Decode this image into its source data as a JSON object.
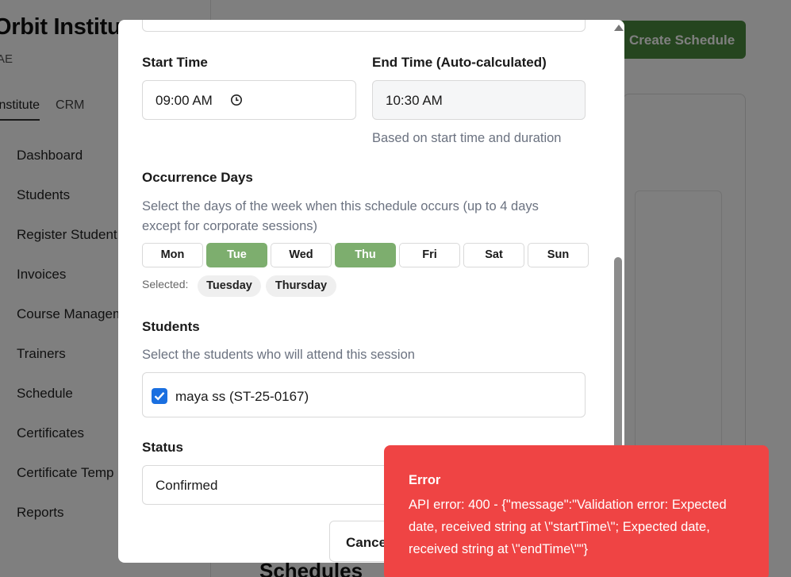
{
  "background": {
    "brand": "Orbit Institu",
    "brand_sub": "AE",
    "tabs": [
      "Institute",
      "CRM"
    ],
    "nav": [
      "Dashboard",
      "Students",
      "Register Student",
      "Invoices",
      "Course Managem",
      "Trainers",
      "Schedule",
      "Certificates",
      "Certificate Temp",
      "Reports"
    ],
    "create_button": "Create Schedule",
    "section_title": "Schedules"
  },
  "modal": {
    "start_time": {
      "label": "Start Time",
      "value": "09:00 AM"
    },
    "end_time": {
      "label": "End Time (Auto-calculated)",
      "value": "10:30 AM",
      "help": "Based on start time and duration"
    },
    "occurrence": {
      "label": "Occurrence Days",
      "help": "Select the days of the week when this schedule occurs (up to 4 days except for corporate sessions)",
      "days": [
        {
          "label": "Mon",
          "selected": false
        },
        {
          "label": "Tue",
          "selected": true
        },
        {
          "label": "Wed",
          "selected": false
        },
        {
          "label": "Thu",
          "selected": true
        },
        {
          "label": "Fri",
          "selected": false
        },
        {
          "label": "Sat",
          "selected": false
        },
        {
          "label": "Sun",
          "selected": false
        }
      ],
      "selected_label": "Selected:",
      "selected_chips": [
        "Tuesday",
        "Thursday"
      ]
    },
    "students": {
      "label": "Students",
      "help": "Select the students who will attend this session",
      "items": [
        {
          "name": "maya ss (ST-25-0167)",
          "checked": true
        }
      ]
    },
    "status": {
      "label": "Status",
      "value": "Confirmed"
    },
    "cancel_button": "Cancel"
  },
  "toast": {
    "title": "Error",
    "message": "API error: 400 - {\"message\":\"Validation error: Expected date, received string at \\\"startTime\\\"; Expected date, received string at \\\"endTime\\\"\"}"
  },
  "colors": {
    "day_selected": "#7dae6e",
    "checkbox": "#1a6fe0",
    "toast_bg": "#ef4444",
    "primary_green": "#4a8a3e"
  }
}
